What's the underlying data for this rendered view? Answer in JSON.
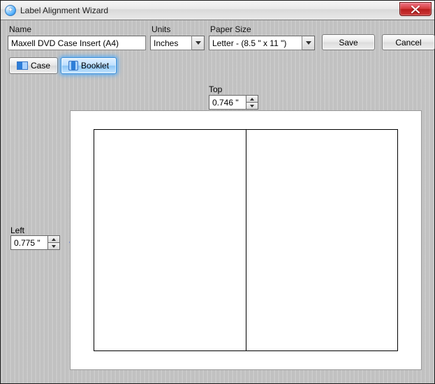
{
  "window": {
    "title": "Label Alignment Wizard"
  },
  "form": {
    "name_label": "Name",
    "name_value": "Maxell DVD Case Insert (A4)",
    "units_label": "Units",
    "units_value": "Inches",
    "paper_label": "Paper Size",
    "paper_value": "Letter - (8.5 \" x 11 \")",
    "save": "Save",
    "cancel": "Cancel"
  },
  "tabs": {
    "case": "Case",
    "booklet": "Booklet"
  },
  "margins": {
    "top_label": "Top",
    "top_value": "0.746 \"",
    "left_label": "Left",
    "left_value": "0.775 \""
  }
}
